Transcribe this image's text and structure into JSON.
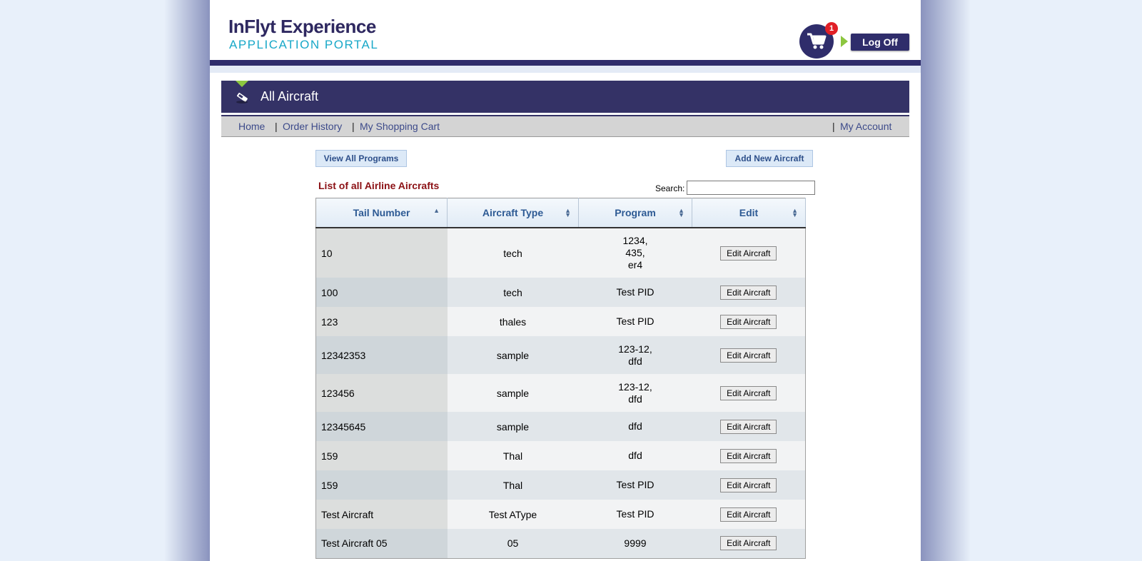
{
  "header": {
    "logo_title": "InFlyt Experience",
    "logo_subtitle": "APPLICATION PORTAL",
    "cart_count": "1",
    "logoff_label": "Log Off"
  },
  "page_title": "All Aircraft",
  "nav": {
    "home": "Home",
    "order_history": "Order History",
    "shopping_cart": "My Shopping Cart",
    "my_account": "My Account",
    "separator": "|"
  },
  "actions": {
    "view_all_programs": "View All Programs",
    "add_new_aircraft": "Add New Aircraft"
  },
  "list": {
    "title": "List of all Airline Aircrafts",
    "search_label": "Search:",
    "search_value": ""
  },
  "table": {
    "columns": [
      "Tail Number",
      "Aircraft Type",
      "Program",
      "Edit"
    ],
    "edit_label": "Edit Aircraft",
    "rows": [
      {
        "tail": "10",
        "type": "tech",
        "program": [
          "1234,",
          "435,",
          "er4"
        ]
      },
      {
        "tail": "100",
        "type": "tech",
        "program": [
          "Test PID"
        ]
      },
      {
        "tail": "123",
        "type": "thales",
        "program": [
          "Test PID"
        ]
      },
      {
        "tail": "12342353",
        "type": "sample",
        "program": [
          "123-12,",
          "dfd"
        ]
      },
      {
        "tail": "123456",
        "type": "sample",
        "program": [
          "123-12,",
          "dfd"
        ]
      },
      {
        "tail": "12345645",
        "type": "sample",
        "program": [
          "dfd"
        ]
      },
      {
        "tail": "159",
        "type": "Thal",
        "program": [
          "dfd"
        ]
      },
      {
        "tail": "159",
        "type": "Thal",
        "program": [
          "Test PID"
        ]
      },
      {
        "tail": "Test Aircraft",
        "type": "Test AType",
        "program": [
          "Test PID"
        ]
      },
      {
        "tail": "Test Aircraft 05",
        "type": "05",
        "program": [
          "9999"
        ]
      }
    ]
  },
  "colors": {
    "brand_navy": "#2f2d6b",
    "accent_green": "#8cc63f",
    "accent_cyan": "#18a8c8",
    "list_title_red": "#8b1014",
    "badge_red": "#e11f26"
  },
  "icons": [
    "cart-icon",
    "phone-icon",
    "sort-asc-icon",
    "sort-both-icon"
  ]
}
